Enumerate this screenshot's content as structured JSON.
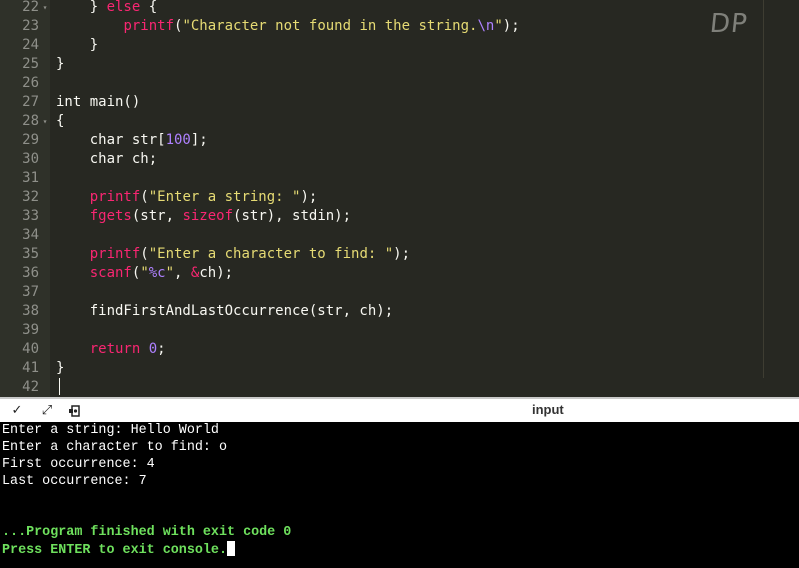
{
  "editor": {
    "lines": [
      {
        "num": "22",
        "fold": true,
        "tokens": [
          {
            "t": "    } "
          },
          {
            "t": "else",
            "c": "k"
          },
          {
            "t": " {"
          }
        ]
      },
      {
        "num": "23",
        "fold": false,
        "tokens": [
          {
            "t": "        "
          },
          {
            "t": "printf",
            "c": "k"
          },
          {
            "t": "("
          },
          {
            "t": "\"Character not found in the string.",
            "c": "s"
          },
          {
            "t": "\\n",
            "c": "n"
          },
          {
            "t": "\"",
            "c": "s"
          },
          {
            "t": ");"
          }
        ]
      },
      {
        "num": "24",
        "fold": false,
        "tokens": [
          {
            "t": "    }"
          }
        ]
      },
      {
        "num": "25",
        "fold": false,
        "tokens": [
          {
            "t": "}"
          }
        ]
      },
      {
        "num": "26",
        "fold": false,
        "tokens": []
      },
      {
        "num": "27",
        "fold": false,
        "tokens": [
          {
            "t": "int main()"
          }
        ]
      },
      {
        "num": "28",
        "fold": true,
        "tokens": [
          {
            "t": "{"
          }
        ]
      },
      {
        "num": "29",
        "fold": false,
        "tokens": [
          {
            "t": "    char str["
          },
          {
            "t": "100",
            "c": "n"
          },
          {
            "t": "];"
          }
        ]
      },
      {
        "num": "30",
        "fold": false,
        "tokens": [
          {
            "t": "    char ch;"
          }
        ]
      },
      {
        "num": "31",
        "fold": false,
        "tokens": []
      },
      {
        "num": "32",
        "fold": false,
        "tokens": [
          {
            "t": "    "
          },
          {
            "t": "printf",
            "c": "k"
          },
          {
            "t": "("
          },
          {
            "t": "\"Enter a string: \"",
            "c": "s"
          },
          {
            "t": ");"
          }
        ]
      },
      {
        "num": "33",
        "fold": false,
        "tokens": [
          {
            "t": "    "
          },
          {
            "t": "fgets",
            "c": "k"
          },
          {
            "t": "(str, "
          },
          {
            "t": "sizeof",
            "c": "k"
          },
          {
            "t": "(str), stdin);"
          }
        ]
      },
      {
        "num": "34",
        "fold": false,
        "tokens": []
      },
      {
        "num": "35",
        "fold": false,
        "tokens": [
          {
            "t": "    "
          },
          {
            "t": "printf",
            "c": "k"
          },
          {
            "t": "("
          },
          {
            "t": "\"Enter a character to find: \"",
            "c": "s"
          },
          {
            "t": ");"
          }
        ]
      },
      {
        "num": "36",
        "fold": false,
        "tokens": [
          {
            "t": "    "
          },
          {
            "t": "scanf",
            "c": "k"
          },
          {
            "t": "("
          },
          {
            "t": "\"",
            "c": "s"
          },
          {
            "t": "%c",
            "c": "n"
          },
          {
            "t": "\"",
            "c": "s"
          },
          {
            "t": ", "
          },
          {
            "t": "&",
            "c": "k"
          },
          {
            "t": "ch);"
          }
        ]
      },
      {
        "num": "37",
        "fold": false,
        "tokens": []
      },
      {
        "num": "38",
        "fold": false,
        "tokens": [
          {
            "t": "    findFirstAndLastOccurrence(str, ch);"
          }
        ]
      },
      {
        "num": "39",
        "fold": false,
        "tokens": []
      },
      {
        "num": "40",
        "fold": false,
        "tokens": [
          {
            "t": "    "
          },
          {
            "t": "return",
            "c": "k"
          },
          {
            "t": " "
          },
          {
            "t": "0",
            "c": "n"
          },
          {
            "t": ";"
          }
        ]
      },
      {
        "num": "41",
        "fold": false,
        "tokens": [
          {
            "t": "}"
          }
        ]
      },
      {
        "num": "42",
        "fold": false,
        "tokens": []
      }
    ],
    "watermark": "DP",
    "colors": {
      "background": "#272822",
      "keyword": "#f92672",
      "string": "#e6db74",
      "number": "#ae81ff",
      "text": "#f8f8f2"
    }
  },
  "toolbar": {
    "label": "input",
    "icons": [
      "chevron-down-icon",
      "expand-icon",
      "settings-copy-icon"
    ]
  },
  "console": {
    "output": [
      "Enter a string: Hello World",
      "Enter a character to find: o",
      "First occurrence: 4",
      "Last occurrence: 7"
    ],
    "exit_message": "...Program finished with exit code 0",
    "prompt": "Press ENTER to exit console."
  }
}
